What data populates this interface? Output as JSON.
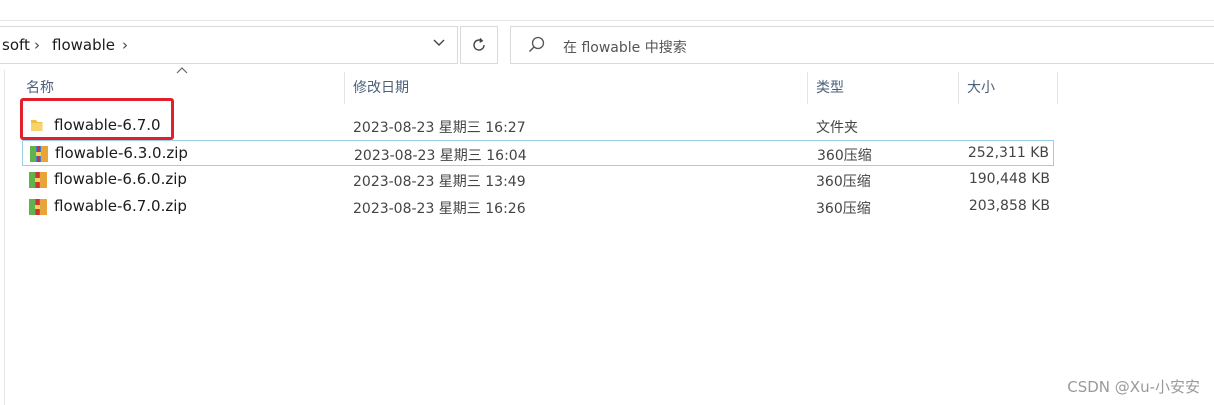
{
  "address_bar": {
    "crumbs": [
      "soft",
      "flowable"
    ]
  },
  "search": {
    "placeholder": "在 flowable 中搜索"
  },
  "columns": {
    "name": "名称",
    "date": "修改日期",
    "type": "类型",
    "size": "大小"
  },
  "files": [
    {
      "name": "flowable-6.7.0",
      "date": "2023-08-23 星期三 16:27",
      "type": "文件夹",
      "size": "",
      "icon": "folder-icon"
    },
    {
      "name": "flowable-6.3.0.zip",
      "date": "2023-08-23 星期三 16:04",
      "type": "360压缩",
      "size": "252,311 KB",
      "icon": "zip-archive-icon"
    },
    {
      "name": "flowable-6.6.0.zip",
      "date": "2023-08-23 星期三 13:49",
      "type": "360压缩",
      "size": "190,448 KB",
      "icon": "zip-archive-icon"
    },
    {
      "name": "flowable-6.7.0.zip",
      "date": "2023-08-23 星期三 16:26",
      "type": "360压缩",
      "size": "203,858 KB",
      "icon": "zip-archive-icon"
    }
  ],
  "watermark": "CSDN @Xu-小安安",
  "colors": {
    "highlight_border": "#99d1e6",
    "annotation_red": "#e0202a",
    "folder": "#f1c040"
  }
}
